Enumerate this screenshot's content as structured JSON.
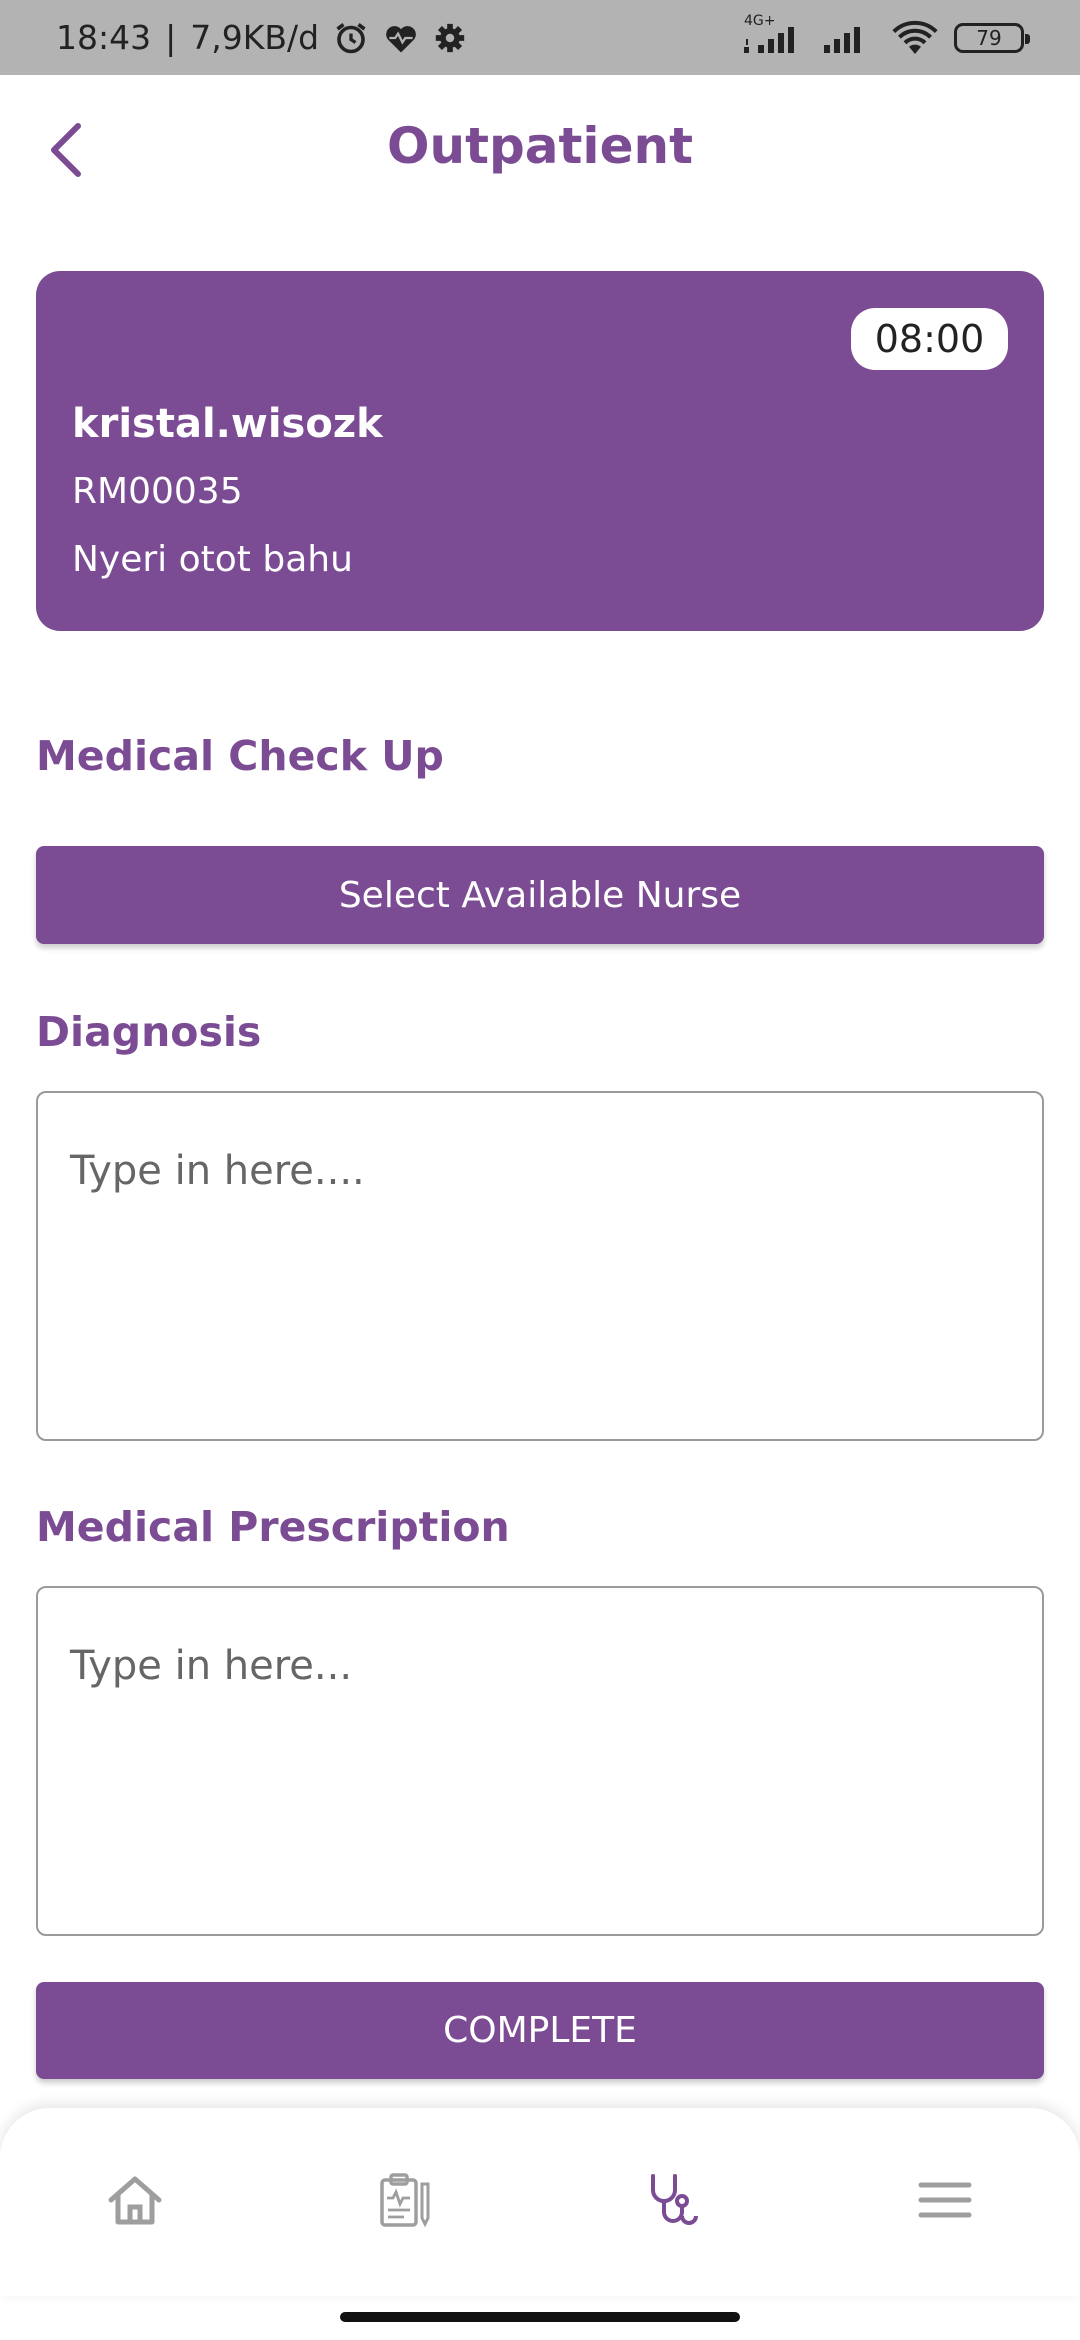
{
  "status_bar": {
    "time": "18:43",
    "separator": "|",
    "speed": "7,9KB/d",
    "network": "4G+",
    "battery": "79"
  },
  "header": {
    "title": "Outpatient"
  },
  "patient": {
    "time": "08:00",
    "name": "kristal.wisozk",
    "record_number": "RM00035",
    "complaint": "Nyeri otot bahu"
  },
  "medical_checkup": {
    "title": "Medical Check Up",
    "nurse_button": "Select Available Nurse"
  },
  "diagnosis": {
    "title": "Diagnosis",
    "value": "",
    "placeholder": "Type in here...."
  },
  "prescription": {
    "title": "Medical Prescription",
    "value": "",
    "placeholder": "Type in here..."
  },
  "complete_button": "COMPLETE",
  "nav": {
    "items": [
      {
        "icon": "home-icon",
        "active": false
      },
      {
        "icon": "clipboard-icon",
        "active": false
      },
      {
        "icon": "stethoscope-icon",
        "active": true
      },
      {
        "icon": "menu-icon",
        "active": false
      }
    ]
  },
  "colors": {
    "primary": "#7b4b93",
    "inactive": "#9e9e9e"
  }
}
